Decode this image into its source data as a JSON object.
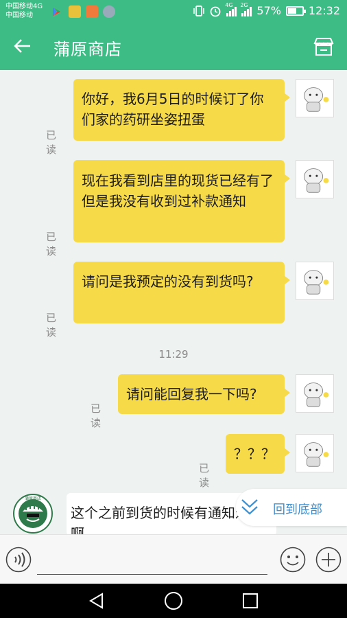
{
  "status_bar": {
    "carrier1": "中国移动4G",
    "carrier2": "中国移动",
    "net1": "4G",
    "net2": "2G",
    "battery": "57%",
    "battery_level": 0.57,
    "time": "12:32"
  },
  "header": {
    "title": "蒲原商店",
    "back_icon": "arrow-left-icon",
    "shop_icon": "storefront-icon"
  },
  "messages": [
    {
      "text": "你好，我6月5日的时候订了你们家的药研坐姿扭蛋",
      "status": "已读"
    },
    {
      "text": "现在我看到店里的现货已经有了但是我没有收到过补款通知",
      "status": "已读"
    },
    {
      "text": "请问是我预定的没有到货吗?",
      "status": "已读"
    },
    {
      "text": "请问能回复我一下吗?",
      "status": "已读"
    },
    {
      "text": "？？？",
      "status": "已读"
    }
  ],
  "timestamp": "11:29",
  "incoming": {
    "text": "这个之前到货的时候有通知过的啊",
    "avatar_text": "蒲原商店"
  },
  "jump_button": {
    "label": "回到底部",
    "icon": "double-chevron-down-icon"
  },
  "input_bar": {
    "voice_icon": "voice-icon",
    "emoji_icon": "emoji-icon",
    "add_icon": "plus-icon"
  },
  "nav_bar": {
    "back_icon": "nav-back-icon",
    "home_icon": "nav-home-icon",
    "recent_icon": "nav-recent-icon"
  },
  "colors": {
    "accent": "#3dbd85",
    "bubble": "#f6da48",
    "link": "#3e8fd0"
  }
}
